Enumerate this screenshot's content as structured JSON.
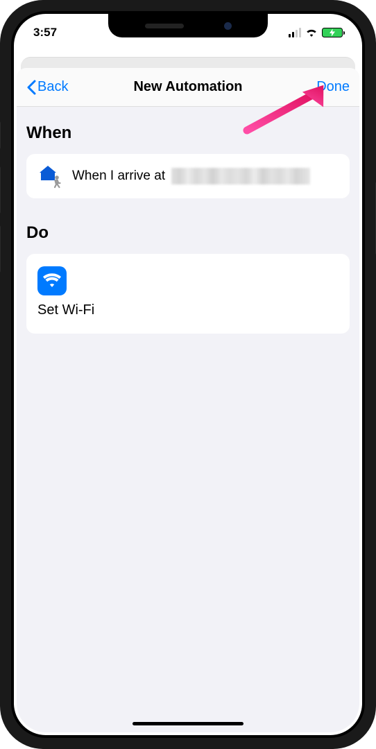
{
  "status_bar": {
    "time": "3:57"
  },
  "navigation": {
    "back_label": "Back",
    "title": "New Automation",
    "done_label": "Done"
  },
  "sections": {
    "when": {
      "header": "When",
      "condition_prefix": "When I arrive at"
    },
    "do": {
      "header": "Do",
      "action_label": "Set Wi-Fi"
    }
  },
  "colors": {
    "accent": "#007aff",
    "background": "#f2f2f7"
  }
}
